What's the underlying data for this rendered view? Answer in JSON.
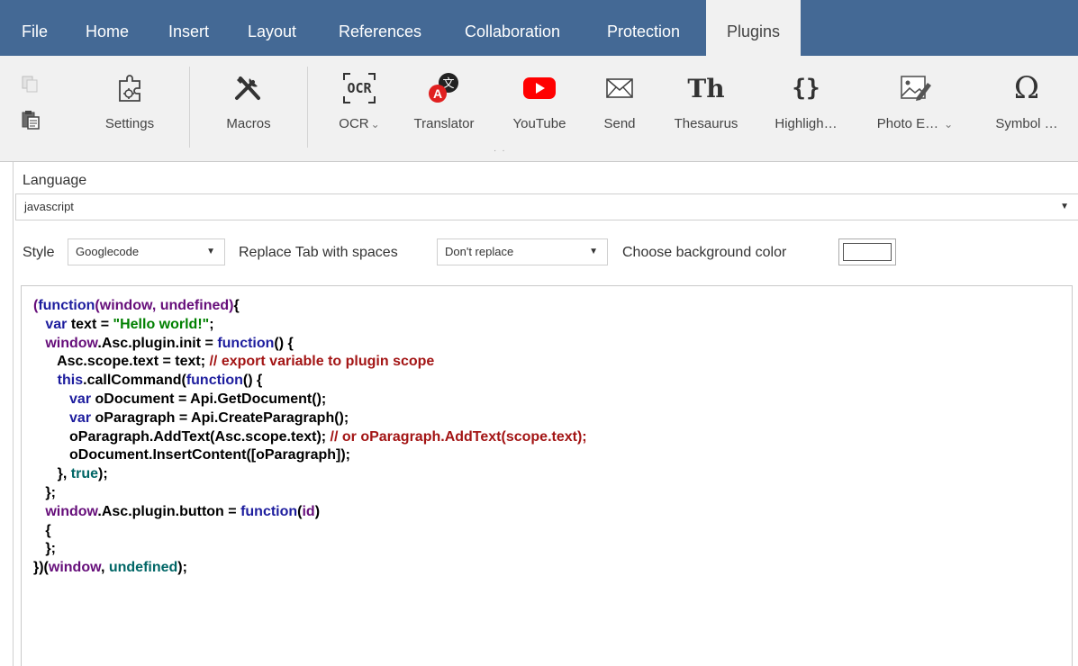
{
  "menu": {
    "tabs": [
      "File",
      "Home",
      "Insert",
      "Layout",
      "References",
      "Collaboration",
      "Protection",
      "Plugins"
    ],
    "active_tab": "Plugins"
  },
  "ribbon": {
    "buttons": [
      {
        "label": "Settings",
        "icon": "settings-puzzle-icon"
      },
      {
        "label": "Macros",
        "icon": "macros-tools-icon"
      },
      {
        "label": "OCR",
        "icon": "ocr-icon",
        "dropdown": true
      },
      {
        "label": "Translator",
        "icon": "translator-icon"
      },
      {
        "label": "YouTube",
        "icon": "youtube-icon"
      },
      {
        "label": "Send",
        "icon": "envelope-icon"
      },
      {
        "label": "Thesaurus",
        "icon": "thesaurus-icon"
      },
      {
        "label": "Highligh…",
        "icon": "highlight-code-icon"
      },
      {
        "label": "Photo E…",
        "icon": "photo-editor-icon",
        "dropdown": true
      },
      {
        "label": "Symbol …",
        "icon": "omega-symbol-icon"
      }
    ],
    "ocr_icon_text": "OCR",
    "thesaurus_icon_text": "Th",
    "highlight_icon_text": "{}",
    "omega_icon_text": "Ω",
    "chevron": "⌄"
  },
  "panel": {
    "language_label": "Language",
    "language_value": "javascript",
    "style_label": "Style",
    "style_value": "Googlecode",
    "replace_tab_label": "Replace Tab with spaces",
    "replace_tab_value": "Don't replace",
    "bg_color_label": "Choose background color",
    "bg_color_value": "#ffffff",
    "dropdown_arrow": "▼"
  },
  "code": {
    "lines": [
      [
        [
          "p",
          "("
        ],
        [
          "k",
          "function"
        ],
        [
          "p",
          "(window, undefined)"
        ],
        [
          "t",
          "{"
        ]
      ],
      [
        [
          "t",
          "   "
        ],
        [
          "k",
          "var"
        ],
        [
          "t",
          " text = "
        ],
        [
          "s",
          "\"Hello world!\""
        ],
        [
          "t",
          ";"
        ]
      ],
      [
        [
          "t",
          "   "
        ],
        [
          "p",
          "window"
        ],
        [
          "t",
          ".Asc.plugin.init = "
        ],
        [
          "k",
          "function"
        ],
        [
          "t",
          "() {"
        ]
      ],
      [
        [
          "t",
          "      Asc.scope.text = text; "
        ],
        [
          "c",
          "// export variable to plugin scope"
        ]
      ],
      [
        [
          "t",
          "      "
        ],
        [
          "k",
          "this"
        ],
        [
          "t",
          ".callCommand("
        ],
        [
          "k",
          "function"
        ],
        [
          "t",
          "() {"
        ]
      ],
      [
        [
          "t",
          "         "
        ],
        [
          "k",
          "var"
        ],
        [
          "t",
          " oDocument = Api.GetDocument();"
        ]
      ],
      [
        [
          "t",
          "         "
        ],
        [
          "k",
          "var"
        ],
        [
          "t",
          " oParagraph = Api.CreateParagraph();"
        ]
      ],
      [
        [
          "t",
          "         oParagraph.AddText(Asc.scope.text); "
        ],
        [
          "c",
          "// or oParagraph.AddText(scope.text);"
        ]
      ],
      [
        [
          "t",
          "         oDocument.InsertContent([oParagraph]);"
        ]
      ],
      [
        [
          "t",
          "      }, "
        ],
        [
          "l",
          "true"
        ],
        [
          "t",
          ");"
        ]
      ],
      [
        [
          "t",
          "   };"
        ]
      ],
      [
        [
          "t",
          "   "
        ],
        [
          "p",
          "window"
        ],
        [
          "t",
          ".Asc.plugin.button = "
        ],
        [
          "k",
          "function"
        ],
        [
          "t",
          "("
        ],
        [
          "p",
          "id"
        ],
        [
          "t",
          ")"
        ]
      ],
      [
        [
          "t",
          "   {"
        ]
      ],
      [
        [
          "t",
          "   };"
        ]
      ],
      [
        [
          "t",
          "})("
        ],
        [
          "p",
          "window"
        ],
        [
          "t",
          ", "
        ],
        [
          "l",
          "undefined"
        ],
        [
          "t",
          ");"
        ]
      ]
    ]
  },
  "colors": {
    "menubar": "#446995",
    "ribbon": "#f1f1f1",
    "youtube_red": "#ff0000",
    "translator_red": "#e02020",
    "keyword": "#1d1d9e",
    "identifier": "#660e7a",
    "string": "#008000",
    "comment": "#a31515",
    "literal": "#006666"
  }
}
